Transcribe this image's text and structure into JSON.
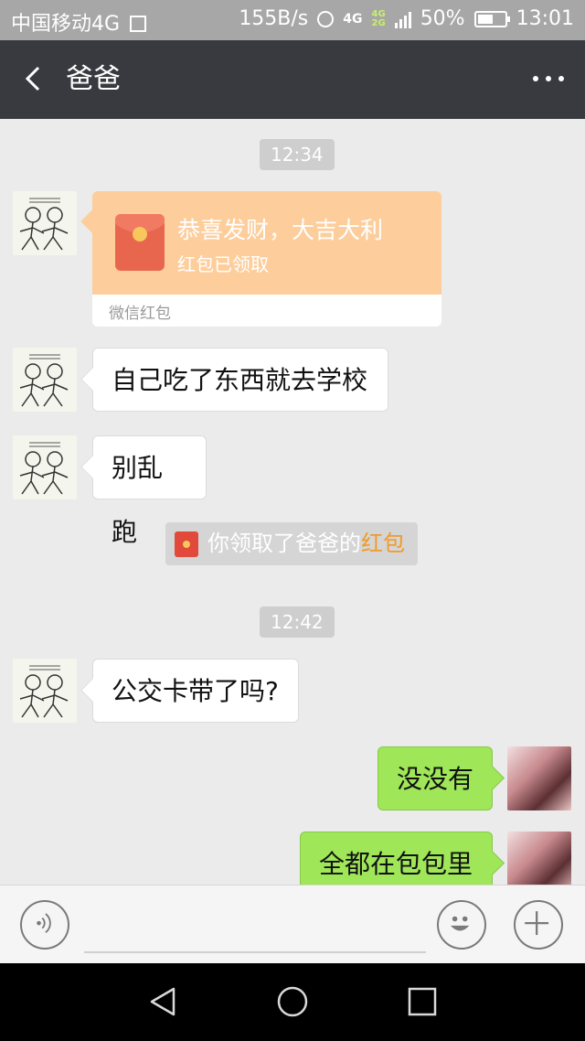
{
  "status_bar": {
    "carrier": "中国移动4G",
    "speed": "155B/s",
    "network_top": "4G",
    "network_badge_top": "4G",
    "network_badge_bottom": "2G",
    "battery": "50%",
    "time": "13:01"
  },
  "header": {
    "title": "爸爸"
  },
  "messages": {
    "ts1": "12:34",
    "red_packet": {
      "title": "恭喜发财，大吉大利",
      "status": "红包已领取",
      "footer": "微信红包"
    },
    "m1": "自己吃了东西就去学校",
    "m2": "别乱跑",
    "notice_prefix": "你领取了爸爸的",
    "notice_link": "红包",
    "ts2": "12:42",
    "m3": "公交卡带了吗?",
    "m4": "没没有",
    "m5": "全都在包包里"
  },
  "input": {
    "placeholder": ""
  },
  "colors": {
    "accent_green": "#9fe658",
    "header_bg": "#393a3f",
    "red_packet": "#fdce9c",
    "notice_link": "#f19a28"
  }
}
